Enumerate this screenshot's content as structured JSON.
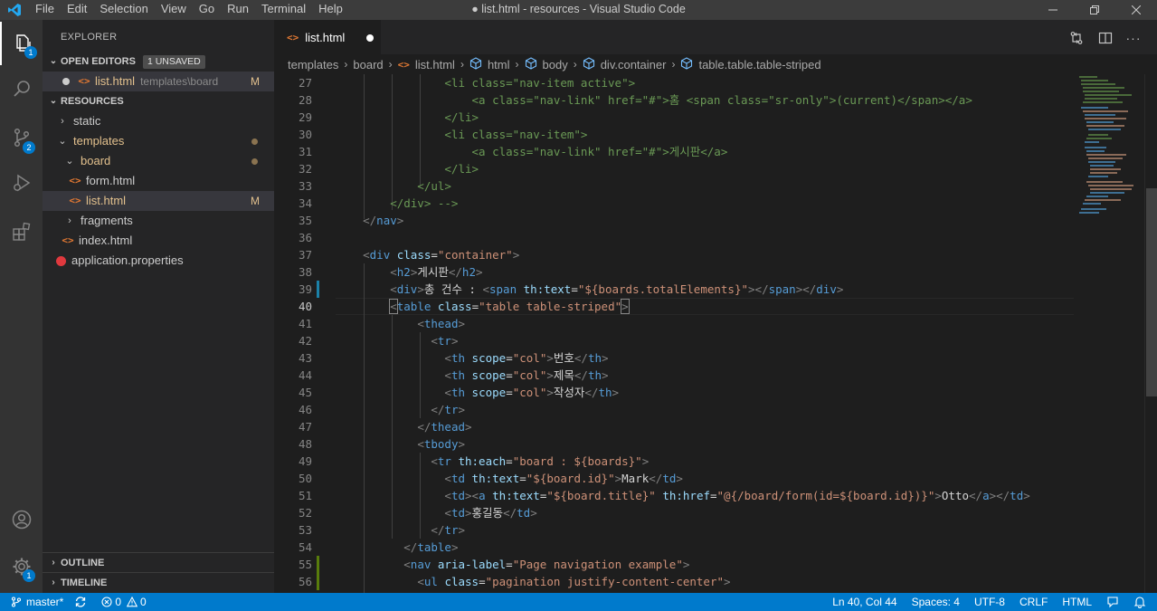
{
  "window": {
    "title": "● list.html - resources - Visual Studio Code",
    "menu": [
      "File",
      "Edit",
      "Selection",
      "View",
      "Go",
      "Run",
      "Terminal",
      "Help"
    ]
  },
  "activity_bar": {
    "explorer_badge": "1",
    "scm_badge": "2",
    "settings_badge": "1"
  },
  "sidebar": {
    "title": "EXPLORER",
    "open_editors": {
      "label": "OPEN EDITORS",
      "unsaved": "1 UNSAVED",
      "file": "list.html",
      "path": "templates\\board",
      "status": "M"
    },
    "folder": "RESOURCES",
    "tree": {
      "static": "static",
      "templates": "templates",
      "board": "board",
      "form": "form.html",
      "list": "list.html",
      "list_status": "M",
      "fragments": "fragments",
      "index": "index.html",
      "props": "application.properties"
    },
    "outline": "OUTLINE",
    "timeline": "TIMELINE"
  },
  "tab": {
    "label": "list.html"
  },
  "breadcrumb": [
    "templates",
    "board",
    "list.html",
    "html",
    "body",
    "div.container",
    "table.table.table-striped"
  ],
  "editor": {
    "line_numbers": [
      "27",
      "28",
      "29",
      "30",
      "31",
      "32",
      "33",
      "34",
      "35",
      "36",
      "37",
      "38",
      "39",
      "40",
      "41",
      "42",
      "43",
      "44",
      "45",
      "46",
      "47",
      "48",
      "49",
      "50",
      "51",
      "52",
      "53",
      "54",
      "55",
      "56"
    ]
  },
  "status": {
    "branch": "master*",
    "errors": "0",
    "warnings": "0",
    "position": "Ln 40, Col 44",
    "spaces": "Spaces: 4",
    "encoding": "UTF-8",
    "eol": "CRLF",
    "language": "HTML"
  },
  "colors": {
    "accent": "#007acc",
    "modified": "#e2c08d",
    "tag": "#569cd6",
    "attribute": "#9cdcfe",
    "string": "#ce9178"
  }
}
